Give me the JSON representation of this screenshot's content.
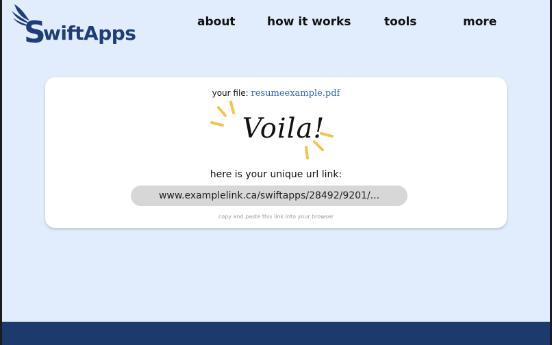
{
  "brand": {
    "name": "SwiftApps",
    "name_rest": "wiftApps",
    "name_initial": "S",
    "primary_color": "#1f3d7a"
  },
  "nav": [
    {
      "label": "about"
    },
    {
      "label": "how it works"
    },
    {
      "label": "tools"
    },
    {
      "label": "more"
    }
  ],
  "result": {
    "file_prefix": "your file:",
    "file_name": "resumeexample.pdf",
    "headline": "Voila!",
    "link_label": "here is your unique url link:",
    "url": "www.examplelink.ca/swiftapps/28492/9201/...",
    "hint": "copy and paste this link into your browser"
  },
  "colors": {
    "background": "#e1edfd",
    "card": "#ffffff",
    "pill": "#d7d7d7",
    "footer": "#1c3a6b",
    "sparkle": "#f2c64a",
    "link": "#2e64c9"
  }
}
